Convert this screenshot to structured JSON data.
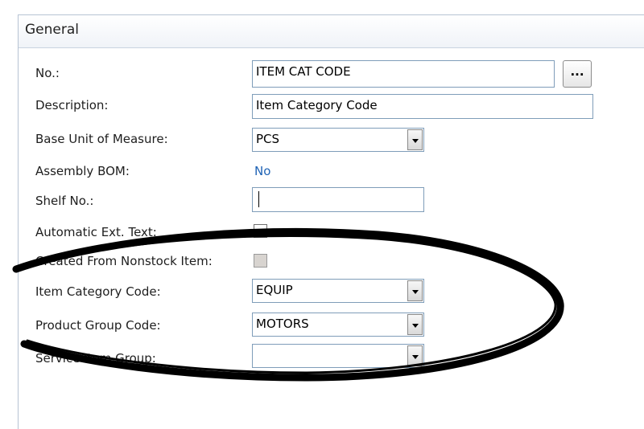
{
  "section": {
    "title": "General"
  },
  "fields": {
    "no": {
      "label": "No.:",
      "value": "ITEM CAT CODE",
      "lookup_label": "..."
    },
    "description": {
      "label": "Description:",
      "value": "Item Category Code"
    },
    "base_unit": {
      "label": "Base Unit of Measure:",
      "value": "PCS"
    },
    "assembly_bom": {
      "label": "Assembly BOM:",
      "value": "No"
    },
    "shelf_no": {
      "label": "Shelf No.:",
      "value": ""
    },
    "automatic_ext_text": {
      "label": "Automatic Ext. Text:",
      "checked": false
    },
    "created_from_nonstock": {
      "label": "Created From Nonstock Item:",
      "checked": false,
      "enabled": false
    },
    "item_category_code": {
      "label": "Item Category Code:",
      "value": "EQUIP"
    },
    "product_group_code": {
      "label": "Product Group Code:",
      "value": "MOTORS"
    },
    "service_item_group": {
      "label": "Service Item Group:",
      "value": ""
    }
  },
  "colors": {
    "link_value": "#1f63b5",
    "field_border": "#7f9db9",
    "annotation_stroke": "#000000"
  }
}
